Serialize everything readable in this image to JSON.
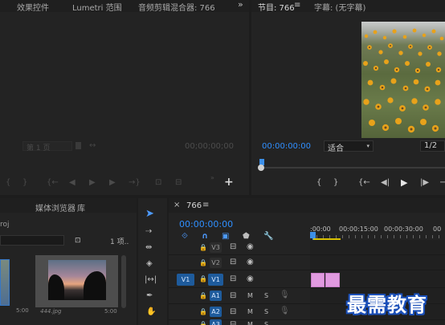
{
  "source_panel": {
    "tabs": [
      "效果控件",
      "Lumetri 范围",
      "音频剪辑混合器: 766"
    ],
    "overflow_icon": "double-chevron-right-icon",
    "page_select": "第 1 页",
    "timecode": "00;00;00;00"
  },
  "program_panel": {
    "tab_title": "节目: 766",
    "menu_icon": "hamburger-icon",
    "caption_tab": "字幕: (无字幕)",
    "timecode": "00:00:00:00",
    "fit_label": "适合",
    "resolution": "1/2"
  },
  "project_panel": {
    "tabs": [
      "媒体浏览器",
      "库"
    ],
    "project_name": "roj",
    "item_count": "1 项..",
    "thumb_label": "444.jpg",
    "thumb_duration": "5:00",
    "thumb2_duration": "5:00"
  },
  "timeline": {
    "close_icon": "×",
    "sequence_name": "766",
    "timecode": "00:00:00:00",
    "ruler_labels": [
      ":00:00",
      "00:00:15:00",
      "00:00:30:00",
      "00"
    ],
    "tracks": [
      {
        "patch": "",
        "name": "V3",
        "kind": "video"
      },
      {
        "patch": "",
        "name": "V2",
        "kind": "video"
      },
      {
        "patch": "V1",
        "name": "V1",
        "kind": "video"
      },
      {
        "patch": "",
        "name": "A1",
        "kind": "audio",
        "m": "M",
        "s": "S"
      },
      {
        "patch": "",
        "name": "A2",
        "kind": "audio",
        "m": "M",
        "s": "S"
      },
      {
        "patch": "",
        "name": "A3",
        "kind": "audio",
        "m": "M",
        "s": "S"
      }
    ]
  },
  "watermark": "最需教育"
}
